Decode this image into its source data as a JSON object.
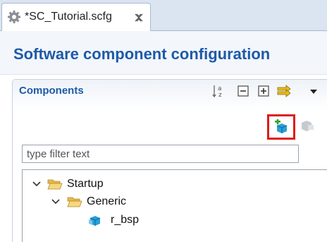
{
  "editor_tab": {
    "title": "*SC_Tutorial.scfg",
    "icon": "gear-icon",
    "close_icon": "close-icon"
  },
  "page": {
    "title": "Software component configuration"
  },
  "components": {
    "section_title": "Components",
    "toolbar": [
      {
        "icon": "sort-alphabetical-icon",
        "label": "Sort"
      },
      {
        "icon": "collapse-all-icon",
        "label": "Collapse All"
      },
      {
        "icon": "expand-all-icon",
        "label": "Expand All"
      },
      {
        "icon": "view-menu-icon",
        "label": "View Menu"
      },
      {
        "icon": "chevron-down-icon",
        "label": "Menu"
      }
    ],
    "add_component": {
      "icon": "add-component-icon",
      "highlight_color": "#e01919"
    },
    "remove_component": {
      "icon": "remove-component-icon"
    },
    "filter": {
      "placeholder": "type filter text",
      "value": ""
    },
    "tree": [
      {
        "label": "Startup",
        "type": "folder",
        "expanded": true
      },
      {
        "label": "Generic",
        "type": "folder",
        "expanded": true
      },
      {
        "label": "r_bsp",
        "type": "component"
      }
    ]
  },
  "colors": {
    "title_blue": "#1d5aa8",
    "tab_bar": "#dbe4f1"
  }
}
